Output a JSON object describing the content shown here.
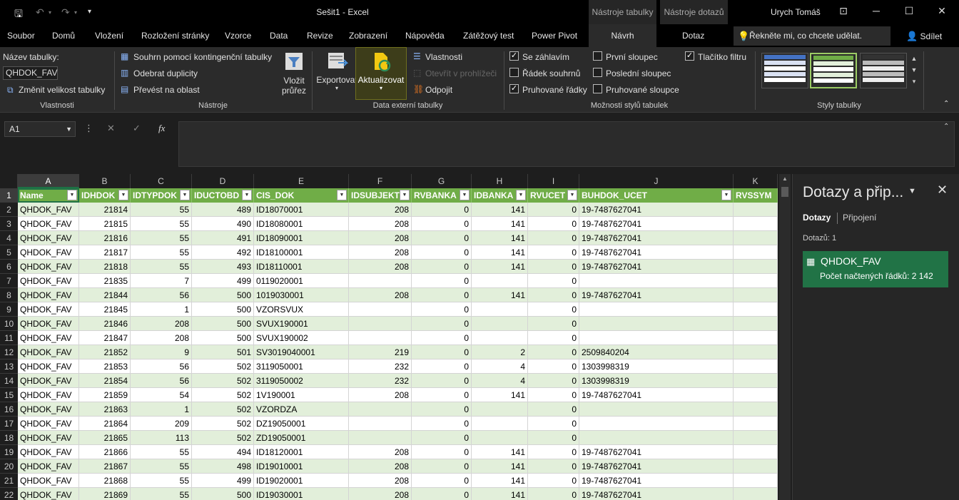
{
  "titlebar": {
    "title": "Sešit1  -  Excel",
    "ctx_tab_1": "Nástroje tabulky",
    "ctx_tab_2": "Nástroje dotazů",
    "user": "Urych Tomáš",
    "icons": [
      "save-icon",
      "undo-icon",
      "redo-icon",
      "customize-qat-icon",
      "ribbon-display-icon",
      "minimize-icon",
      "restore-icon",
      "close-icon"
    ]
  },
  "tabs": {
    "items": [
      "Soubor",
      "Domů",
      "Vložení",
      "Rozložení stránky",
      "Vzorce",
      "Data",
      "Revize",
      "Zobrazení",
      "Nápověda",
      "Zátěžový test",
      "Power Pivot",
      "Návrh",
      "Dotaz"
    ],
    "active": "Návrh",
    "tell_me": "Řekněte mi, co chcete udělat.",
    "share": "Sdílet"
  },
  "ribbon": {
    "vlastnosti": {
      "name_label": "Název tabulky:",
      "name_value": "QHDOK_FAV",
      "resize": "Změnit velikost tabulky",
      "group": "Vlastnosti"
    },
    "nastroje": {
      "pivot": "Souhrn pomocí kontingenční tabulky",
      "dedupe": "Odebrat duplicity",
      "convert": "Převést na oblast",
      "slicer_1": "Vložit",
      "slicer_2": "průřez",
      "group": "Nástroje"
    },
    "externi": {
      "export": "Exportovat",
      "refresh": "Aktualizovat",
      "properties": "Vlastnosti",
      "open_browser": "Otevřít v prohlížeči",
      "unlink": "Odpojit",
      "group": "Data externí tabulky"
    },
    "moznosti": {
      "header_row": "Se záhlavím",
      "total_row": "Řádek souhrnů",
      "banded_rows": "Pruhované řádky",
      "first_col": "První sloupec",
      "last_col": "Poslední sloupec",
      "banded_cols": "Pruhované sloupce",
      "filter_btn": "Tlačítko filtru",
      "checked": {
        "header_row": true,
        "total_row": false,
        "banded_rows": true,
        "first_col": false,
        "last_col": false,
        "banded_cols": false,
        "filter_btn": true
      },
      "group": "Možnosti stylů tabulek"
    },
    "styly": {
      "group": "Styly tabulky"
    }
  },
  "formula_bar": {
    "name_box": "A1",
    "fx": "fx",
    "value": ""
  },
  "grid": {
    "columns": [
      "A",
      "B",
      "C",
      "D",
      "E",
      "F",
      "G",
      "H",
      "I",
      "J",
      "K"
    ],
    "headers": [
      "Name",
      "IDHDOK",
      "IDTYPDOK",
      "IDUCTOBD",
      "CIS_DOK",
      "IDSUBJEKT",
      "RVBANKA",
      "IDBANKA",
      "RVUCET",
      "BUHDOK_UCET",
      "RVSSYM"
    ],
    "row_numbers": [
      "1",
      "2",
      "3",
      "4",
      "5",
      "6",
      "7",
      "8",
      "9",
      "10",
      "11",
      "12",
      "13",
      "14",
      "15",
      "16",
      "17",
      "18",
      "19",
      "20",
      "21",
      "22"
    ],
    "rows": [
      [
        "QHDOK_FAV",
        "21814",
        "55",
        "489",
        "ID18070001",
        "208",
        "0",
        "141",
        "0",
        "19-7487627041",
        ""
      ],
      [
        "QHDOK_FAV",
        "21815",
        "55",
        "490",
        "ID18080001",
        "208",
        "0",
        "141",
        "0",
        "19-7487627041",
        ""
      ],
      [
        "QHDOK_FAV",
        "21816",
        "55",
        "491",
        "ID18090001",
        "208",
        "0",
        "141",
        "0",
        "19-7487627041",
        ""
      ],
      [
        "QHDOK_FAV",
        "21817",
        "55",
        "492",
        "ID18100001",
        "208",
        "0",
        "141",
        "0",
        "19-7487627041",
        ""
      ],
      [
        "QHDOK_FAV",
        "21818",
        "55",
        "493",
        "ID18110001",
        "208",
        "0",
        "141",
        "0",
        "19-7487627041",
        ""
      ],
      [
        "QHDOK_FAV",
        "21835",
        "7",
        "499",
        "0119020001",
        "",
        "0",
        "",
        "0",
        "",
        ""
      ],
      [
        "QHDOK_FAV",
        "21844",
        "56",
        "500",
        "1019030001",
        "208",
        "0",
        "141",
        "0",
        "19-7487627041",
        ""
      ],
      [
        "QHDOK_FAV",
        "21845",
        "1",
        "500",
        "VZORSVUX",
        "",
        "0",
        "",
        "0",
        "",
        ""
      ],
      [
        "QHDOK_FAV",
        "21846",
        "208",
        "500",
        "SVUX190001",
        "",
        "0",
        "",
        "0",
        "",
        ""
      ],
      [
        "QHDOK_FAV",
        "21847",
        "208",
        "500",
        "SVUX190002",
        "",
        "0",
        "",
        "0",
        "",
        ""
      ],
      [
        "QHDOK_FAV",
        "21852",
        "9",
        "501",
        "SV3019040001",
        "219",
        "0",
        "2",
        "0",
        "2509840204",
        ""
      ],
      [
        "QHDOK_FAV",
        "21853",
        "56",
        "502",
        "3119050001",
        "232",
        "0",
        "4",
        "0",
        "1303998319",
        ""
      ],
      [
        "QHDOK_FAV",
        "21854",
        "56",
        "502",
        "3119050002",
        "232",
        "0",
        "4",
        "0",
        "1303998319",
        ""
      ],
      [
        "QHDOK_FAV",
        "21859",
        "54",
        "502",
        "1V190001",
        "208",
        "0",
        "141",
        "0",
        "19-7487627041",
        ""
      ],
      [
        "QHDOK_FAV",
        "21863",
        "1",
        "502",
        "VZORDZA",
        "",
        "0",
        "",
        "0",
        "",
        ""
      ],
      [
        "QHDOK_FAV",
        "21864",
        "209",
        "502",
        "DZ19050001",
        "",
        "0",
        "",
        "0",
        "",
        ""
      ],
      [
        "QHDOK_FAV",
        "21865",
        "113",
        "502",
        "ZD19050001",
        "",
        "0",
        "",
        "0",
        "",
        ""
      ],
      [
        "QHDOK_FAV",
        "21866",
        "55",
        "494",
        "ID18120001",
        "208",
        "0",
        "141",
        "0",
        "19-7487627041",
        ""
      ],
      [
        "QHDOK_FAV",
        "21867",
        "55",
        "498",
        "ID19010001",
        "208",
        "0",
        "141",
        "0",
        "19-7487627041",
        ""
      ],
      [
        "QHDOK_FAV",
        "21868",
        "55",
        "499",
        "ID19020001",
        "208",
        "0",
        "141",
        "0",
        "19-7487627041",
        ""
      ],
      [
        "QHDOK_FAV",
        "21869",
        "55",
        "500",
        "ID19030001",
        "208",
        "0",
        "141",
        "0",
        "19-7487627041",
        ""
      ]
    ]
  },
  "queries_pane": {
    "title": "Dotazy a přip...",
    "tab_queries": "Dotazy",
    "tab_connections": "Připojení",
    "count": "Dotazů: 1",
    "query_name": "QHDOK_FAV",
    "query_rows": "Počet načtených řádků: 2 142"
  },
  "colors": {
    "header_green": "#70ad47",
    "band_green": "#e2efda",
    "query_card": "#217346"
  }
}
